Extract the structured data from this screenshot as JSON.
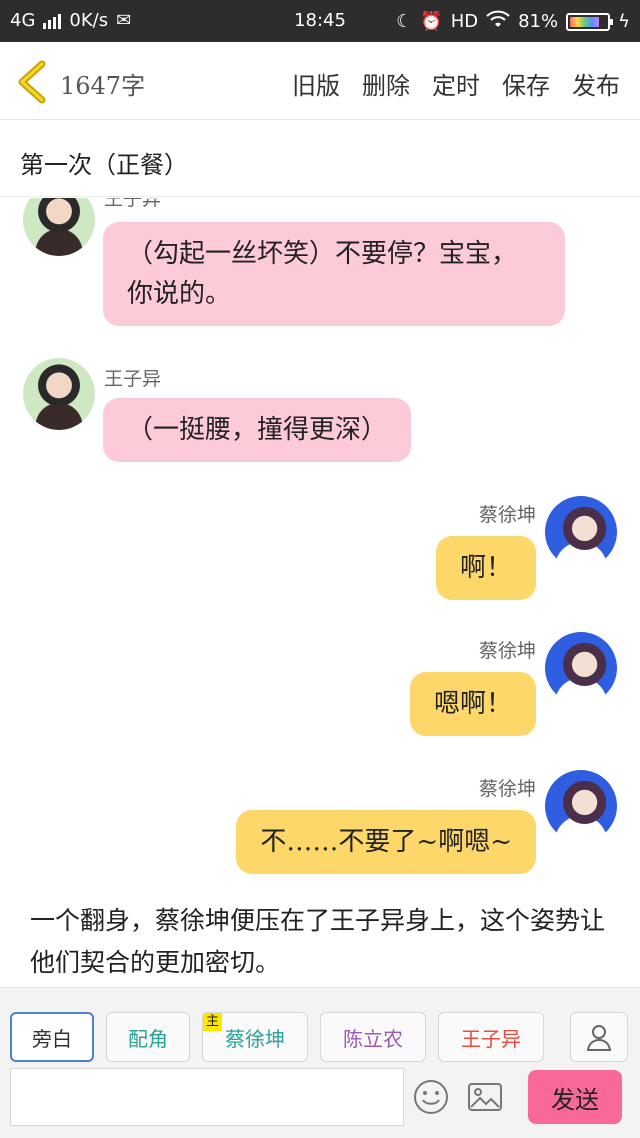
{
  "status_bar": {
    "network": "4G",
    "speed": "0K/s",
    "time": "18:45",
    "hd": "HD",
    "battery": "81%",
    "battery_level": 0.81
  },
  "toolbar": {
    "word_count": "1647字",
    "actions": [
      "旧版",
      "删除",
      "定时",
      "保存",
      "发布"
    ]
  },
  "chapter": {
    "title": "第一次（正餐）"
  },
  "messages": [
    {
      "speaker": "王子异",
      "text": "（勾起一丝坏笑）不要停？宝宝，你说的。",
      "side": "left",
      "color": "pink"
    },
    {
      "speaker": "王子异",
      "text": "（一挺腰，撞得更深）",
      "side": "left",
      "color": "pink"
    },
    {
      "speaker": "蔡徐坤",
      "text": "啊！",
      "side": "right",
      "color": "yellow"
    },
    {
      "speaker": "蔡徐坤",
      "text": "嗯啊！",
      "side": "right",
      "color": "yellow"
    },
    {
      "speaker": "蔡徐坤",
      "text": "不……不要了~啊嗯~",
      "side": "right",
      "color": "yellow"
    }
  ],
  "narration": "一个翻身，蔡徐坤便压在了王子异身上，这个姿势让他们契合的更加密切。",
  "roles": [
    {
      "label": "旁白",
      "color": "#333333"
    },
    {
      "label": "配角",
      "color": "#2aa198"
    },
    {
      "label": "蔡徐坤",
      "color": "#2aa198",
      "tag": "主"
    },
    {
      "label": "陈立农",
      "color": "#9b59b6"
    },
    {
      "label": "王子异",
      "color": "#e74c3c"
    }
  ],
  "composer": {
    "placeholder": "",
    "send_label": "发送"
  },
  "colors": {
    "pink_bubble": "#fdcad7",
    "yellow_bubble": "#fdd769",
    "send_button": "#f8699a",
    "active_border": "#4d7fd1"
  }
}
